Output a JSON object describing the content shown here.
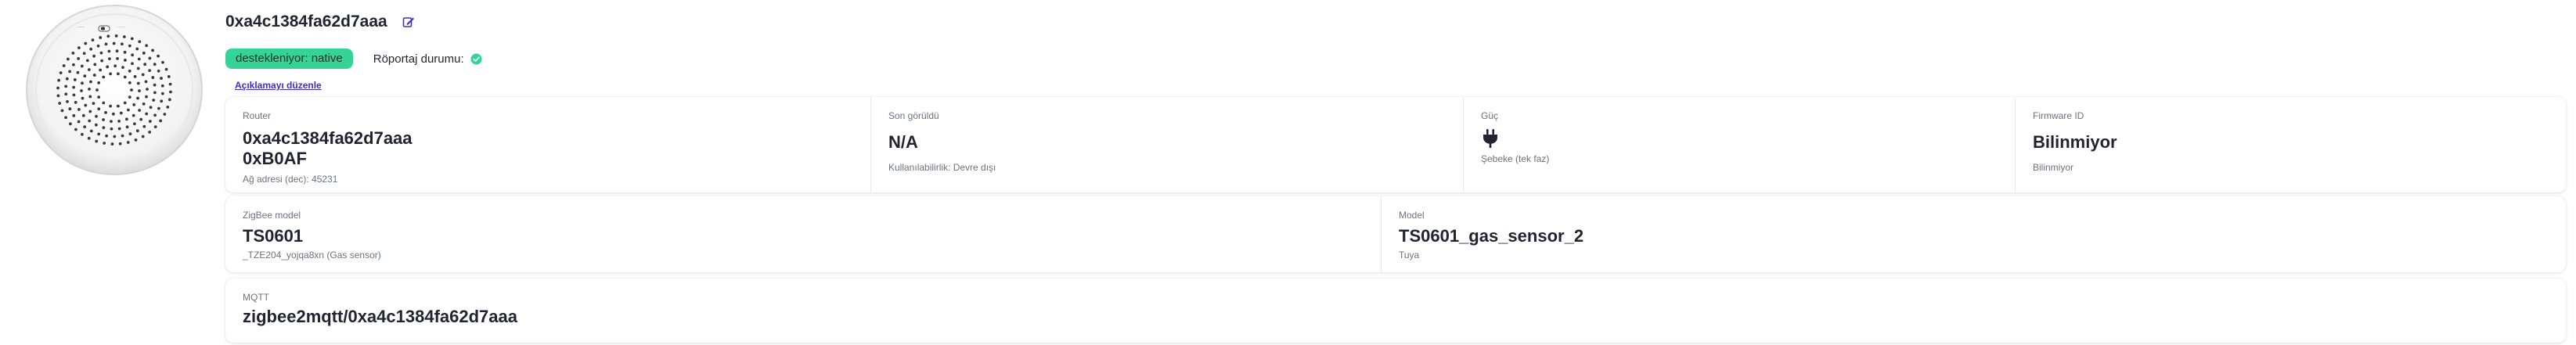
{
  "device": {
    "title": "0xa4c1384fa62d7aaa",
    "image_icon": "smoke-gas-detector-image",
    "edit_icon": "edit-icon",
    "support_badge": "destekleniyor: native",
    "interview_label": "Röportaj durumu:",
    "interview_icon": "check-circle-icon",
    "edit_description_link": "Açıklamayı düzenle"
  },
  "stats_row1": [
    {
      "title": "Router",
      "value": "0xa4c1384fa62d7aaa",
      "value2": "0xB0AF",
      "desc": "Ağ adresi (dec): 45231"
    },
    {
      "title": "Son görüldü",
      "value": "N/A",
      "desc": "Kullanılabilirlik: Devre dışı"
    },
    {
      "title": "Güç",
      "icon": "plug-icon",
      "desc": "Şebeke (tek faz)"
    },
    {
      "title": "Firmware ID",
      "value": "Bilinmiyor",
      "desc": "Bilinmiyor"
    }
  ],
  "stats_row2": [
    {
      "title": "ZigBee model",
      "value": "TS0601",
      "desc": "_TZE204_yojqa8xn (Gas sensor)"
    },
    {
      "title": "Model",
      "value": "TS0601_gas_sensor_2",
      "desc": "Tuya"
    }
  ],
  "stats_row3": [
    {
      "title": "MQTT",
      "value": "zigbee2mqtt/0xa4c1384fa62d7aaa"
    }
  ],
  "colors": {
    "badge_bg": "#36d399",
    "link": "#3d2bd6",
    "check": "#36d399",
    "edit_icon": "#3d2bd6"
  }
}
